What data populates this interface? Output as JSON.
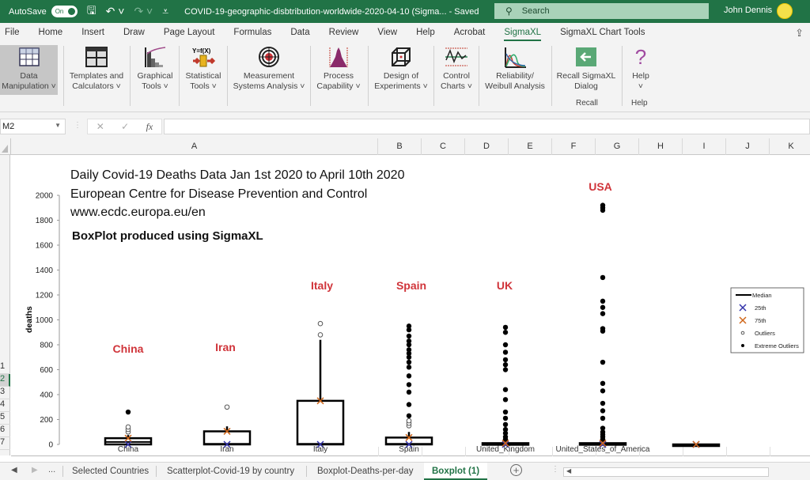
{
  "titlebar": {
    "autosave_label": "AutoSave",
    "autosave_state": "On",
    "document_title": "COVID-19-geographic-disbtribution-worldwide-2020-04-10 (Sigma...  -  Saved",
    "search_placeholder": "Search",
    "user_name": "John Dennis"
  },
  "menu": {
    "items": [
      "File",
      "Home",
      "Insert",
      "Draw",
      "Page Layout",
      "Formulas",
      "Data",
      "Review",
      "View",
      "Help",
      "Acrobat",
      "SigmaXL",
      "SigmaXL Chart Tools"
    ],
    "active": "SigmaXL"
  },
  "ribbon": {
    "buttons": [
      {
        "line1": "Data",
        "line2": "Manipulation ˅",
        "icon": "table-grid-icon"
      },
      {
        "line1": "Templates and",
        "line2": "Calculators ˅",
        "icon": "template-icon"
      },
      {
        "line1": "Graphical",
        "line2": "Tools ˅",
        "icon": "pareto-chart-icon"
      },
      {
        "line1": "Statistical",
        "line2": "Tools ˅",
        "icon": "yfx-icon"
      },
      {
        "line1": "Measurement",
        "line2": "Systems Analysis ˅",
        "icon": "target-icon"
      },
      {
        "line1": "Process",
        "line2": "Capability ˅",
        "icon": "histogram-icon"
      },
      {
        "line1": "Design of",
        "line2": "Experiments ˅",
        "icon": "cube-icon"
      },
      {
        "line1": "Control",
        "line2": "Charts ˅",
        "icon": "control-chart-icon"
      },
      {
        "line1": "Reliability/",
        "line2": "Weibull Analysis",
        "icon": "weibull-icon"
      },
      {
        "line1": "Recall SigmaXL",
        "line2": "Dialog",
        "icon": "recall-arrow-icon"
      },
      {
        "line1": "Help",
        "line2": "˅",
        "icon": "question-icon"
      }
    ],
    "groups": {
      "recall": "Recall",
      "help": "Help"
    }
  },
  "formula_bar": {
    "name_box": "M2",
    "cancel_glyph": "✕",
    "enter_glyph": "✓",
    "fx_label": "fx",
    "formula": ""
  },
  "columns": [
    "A",
    "B",
    "C",
    "D",
    "E",
    "F",
    "G",
    "H",
    "I",
    "J",
    "K"
  ],
  "rows": [
    "1",
    "2",
    "3",
    "4",
    "5",
    "6",
    "7"
  ],
  "selected_row": "2",
  "chart_annotations": {
    "line1": "Daily Covid-19 Deaths Data Jan 1st 2020 to April 10th 2020",
    "line2": "European Centre for Disease Prevention and Control",
    "line3": "www.ecdc.europa.eu/en",
    "subtitle": "BoxPlot produced using SigmaXL",
    "country_labels": [
      "China",
      "Iran",
      "Italy",
      "Spain",
      "UK",
      "USA"
    ]
  },
  "chart_data": {
    "type": "boxplot",
    "title": "Daily Covid-19 Deaths Data Jan 1st 2020 to April 10th 2020",
    "ylabel": "deaths",
    "xlabel": "",
    "ylim": [
      0,
      2000
    ],
    "yticks": [
      0,
      200,
      400,
      600,
      800,
      1000,
      1200,
      1400,
      1600,
      1800,
      2000
    ],
    "grid": false,
    "legend_position": "right",
    "legend": [
      "Median",
      "25th",
      "75th",
      "Outliers",
      "Extreme Outliers"
    ],
    "colors": {
      "box": "#000000",
      "p25": "#3333aa",
      "p75": "#d0661a",
      "label": "#d0343a"
    },
    "categories": [
      "China",
      "Iran",
      "Italy",
      "Spain",
      "United_Kingdom",
      "United_States_of_America",
      ""
    ],
    "series": [
      {
        "name": "China",
        "q1": 0,
        "median": 20,
        "q3": 50,
        "whisker_high": 75,
        "outliers": [
          100,
          120,
          140
        ],
        "extreme_outliers": [
          260
        ]
      },
      {
        "name": "Iran",
        "q1": 0,
        "median": 5,
        "q3": 105,
        "whisker_high": 145,
        "outliers": [
          300
        ],
        "extreme_outliers": []
      },
      {
        "name": "Italy",
        "q1": 0,
        "median": 5,
        "q3": 350,
        "whisker_high": 840,
        "outliers": [
          880,
          970
        ],
        "extreme_outliers": []
      },
      {
        "name": "Spain",
        "q1": 0,
        "median": 5,
        "q3": 55,
        "whisker_high": 100,
        "outliers": [
          150,
          170,
          190
        ],
        "extreme_outliers": [
          230,
          320,
          420,
          480,
          550,
          620,
          660,
          700,
          730,
          760,
          800,
          830,
          870,
          920,
          950
        ]
      },
      {
        "name": "United_Kingdom",
        "q1": 0,
        "median": 3,
        "q3": 10,
        "whisker_high": 12,
        "outliers": [],
        "extreme_outliers": [
          40,
          60,
          90,
          120,
          160,
          210,
          260,
          360,
          440,
          600,
          640,
          680,
          740,
          800,
          900,
          940
        ]
      },
      {
        "name": "United_States_of_America",
        "q1": 0,
        "median": 3,
        "q3": 10,
        "whisker_high": 12,
        "outliers": [
          20
        ],
        "extreme_outliers": [
          40,
          60,
          80,
          100,
          130,
          210,
          270,
          330,
          430,
          490,
          660,
          910,
          930,
          1050,
          1100,
          1150,
          1340,
          1880,
          1900,
          1920
        ]
      },
      {
        "name": "",
        "q1": 0,
        "median": 0,
        "q3": 0,
        "whisker_high": 0,
        "outliers": [],
        "extreme_outliers": []
      }
    ]
  },
  "sheet_tabs": {
    "ellipsis": "...",
    "tabs": [
      "Selected Countries",
      "Scatterplot-Covid-19 by country",
      "Boxplot-Deaths-per-day",
      "Boxplot (1)"
    ],
    "active": "Boxplot (1)"
  }
}
